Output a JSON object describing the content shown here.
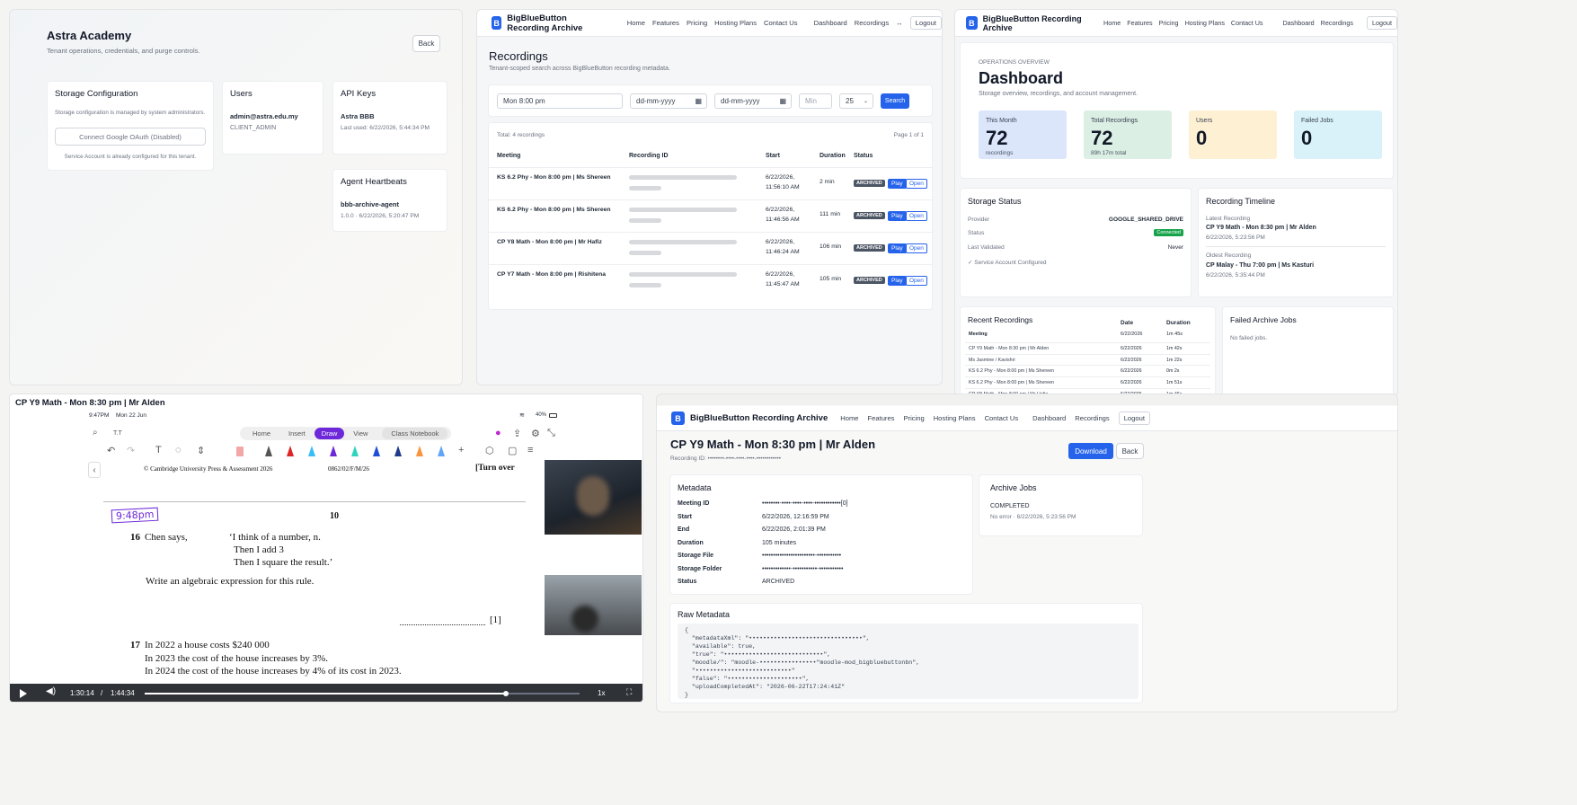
{
  "tenant": {
    "title": "Astra Academy",
    "subtitle": "Tenant operations, credentials, and purge controls.",
    "back_label": "Back",
    "storage": {
      "heading": "Storage Configuration",
      "note": "Storage configuration is managed by system administrators.",
      "oauth_button": "Connect Google OAuth (Disabled)",
      "footer": "Service Account is already configured for this tenant."
    },
    "users": {
      "heading": "Users",
      "email": "admin@astra.edu.my",
      "role": "CLIENT_ADMIN"
    },
    "api_keys": {
      "heading": "API Keys",
      "name": "Astra BBB",
      "last_used": "Last used: 6/22/2026, 5:44:34 PM"
    },
    "heartbeats": {
      "heading": "Agent Heartbeats",
      "agent": "bbb-archive-agent",
      "version": "1.0.0 · 6/22/2026, 5:20:47 PM"
    }
  },
  "brand": "BigBlueButton Recording Archive",
  "logo_letter": "B",
  "nav": {
    "home": "Home",
    "features": "Features",
    "pricing": "Pricing",
    "hosting": "Hosting Plans",
    "contact": "Contact Us",
    "dashboard": "Dashboard",
    "recordings": "Recordings",
    "more": "↔",
    "logout": "Logout"
  },
  "recordings_page": {
    "title": "Recordings",
    "subtitle": "Tenant-scoped search across BigBlueButton recording metadata.",
    "search_value": "Mon 8:00 pm",
    "date_from": "dd-mm-yyyy",
    "date_to": "dd-mm-yyyy",
    "min_placeholder": "Min",
    "page_size": "25",
    "search_button": "Search",
    "total": "Total: 4 recordings",
    "page": "Page 1 of 1",
    "columns": [
      "Meeting",
      "Recording ID",
      "Start",
      "Duration",
      "Status"
    ],
    "rows": [
      {
        "meeting": "KS 6.2 Phy - Mon 8:00 pm | Ms Shereen",
        "start1": "6/22/2026,",
        "start2": "11:56:10 AM",
        "duration": "2 min",
        "status": "ARCHIVED",
        "play": "Play",
        "open": "Open"
      },
      {
        "meeting": "KS 6.2 Phy - Mon 8:00 pm | Ms Shereen",
        "start1": "6/22/2026,",
        "start2": "11:46:56 AM",
        "duration": "111 min",
        "status": "ARCHIVED",
        "play": "Play",
        "open": "Open"
      },
      {
        "meeting": "CP Y8 Math - Mon 8:00 pm | Mr Hafiz",
        "start1": "6/22/2026,",
        "start2": "11:46:24 AM",
        "duration": "106 min",
        "status": "ARCHIVED",
        "play": "Play",
        "open": "Open"
      },
      {
        "meeting": "CP Y7 Math - Mon 8:00 pm | Rishitena",
        "start1": "6/22/2026,",
        "start2": "11:45:47 AM",
        "duration": "105 min",
        "status": "ARCHIVED",
        "play": "Play",
        "open": "Open"
      }
    ]
  },
  "dashboard": {
    "eyebrow": "OPERATIONS OVERVIEW",
    "title": "Dashboard",
    "subtitle": "Storage overview, recordings, and account management.",
    "stats": [
      {
        "label": "This Month",
        "value": "72",
        "sub": "recordings",
        "color": "#dbe6fb"
      },
      {
        "label": "Total Recordings",
        "value": "72",
        "sub": "89h 17m total",
        "color": "#dcefe4"
      },
      {
        "label": "Users",
        "value": "0",
        "sub": "",
        "color": "#fdf0d3"
      },
      {
        "label": "Failed Jobs",
        "value": "0",
        "sub": "",
        "color": "#d9f2f9"
      }
    ],
    "storage_status": {
      "heading": "Storage Status",
      "provider_label": "Provider",
      "provider": "GOOGLE_SHARED_DRIVE",
      "status_label": "Status",
      "status": "Connected",
      "validated_label": "Last Validated",
      "validated": "Never",
      "service": "✓ Service Account Configured"
    },
    "timeline": {
      "heading": "Recording Timeline",
      "latest_label": "Latest Recording",
      "latest_title": "CP Y9 Math - Mon 8:30 pm | Mr Alden",
      "latest_date": "6/22/2026, 5:23:56 PM",
      "oldest_label": "Oldest Recording",
      "oldest_title": "CP Malay - Thu 7:00 pm | Ms Kasturi",
      "oldest_date": "6/22/2026, 5:35:44 PM"
    },
    "recent": {
      "heading": "Recent Recordings",
      "columns": [
        "Meeting",
        "Date",
        "Duration"
      ],
      "rows": [
        {
          "m": "CP Y9 Math - Mon 8:30 pm | Mr Alden",
          "d": "6/22/2026",
          "t": "1m 42s"
        },
        {
          "m": "Ms Jasmine / Kavishri",
          "d": "6/22/2026",
          "t": "1m 22s"
        },
        {
          "m": "KS 6.2 Phy - Mon 8:00 pm | Ms Shereen",
          "d": "6/22/2026",
          "t": "0m 2s"
        },
        {
          "m": "KS 6.2 Phy - Mon 8:00 pm | Ms Shereen",
          "d": "6/22/2026",
          "t": "1m 51s"
        },
        {
          "m": "CP Y8 Math - Mon 8:00 pm | Mr Hafiz",
          "d": "6/22/2026",
          "t": "1m 46s"
        }
      ],
      "first_duration": "1m 45s"
    },
    "failed": {
      "heading": "Failed Archive Jobs",
      "empty": "No failed jobs."
    }
  },
  "player": {
    "title": "CP Y9 Math - Mon 8:30 pm | Mr Alden",
    "status_time": "9:47PM",
    "status_date": "Mon 22 Jun",
    "battery": "40%",
    "font_label": "T.T",
    "tabs": [
      "Home",
      "Insert",
      "Draw",
      "View",
      "Class Notebook"
    ],
    "active_tab": "Draw",
    "page_header_left": "© Cambridge University Press & Assessment 2026",
    "page_header_mid": "0862/02/F/M/26",
    "page_header_right": "[Turn over",
    "handwritten": "9:48pm",
    "page_number": "10",
    "q16_num": "16",
    "q16_text": "Chen says,",
    "q16_quote1": "‘I think of a number, n.",
    "q16_quote2": "Then I add 3",
    "q16_quote3": "Then I square the result.’",
    "q16_instruction": "Write an algebraic expression for this rule.",
    "q16_marks": "[1]",
    "q17_num": "17",
    "q17_l1": "In 2022 a house costs $240 000",
    "q17_l2": "In 2023 the cost of the house increases by 3%.",
    "q17_l3": "In 2024 the cost of the house increases by 4% of its cost in 2023.",
    "time_current": "1:30:14",
    "time_sep": "/",
    "time_total": "1:44:34",
    "speed": "1x",
    "progress": 0.83
  },
  "detail": {
    "title": "CP Y9 Math - Mon 8:30 pm | Mr Alden",
    "recording_id": "Recording ID: ••••••••-••••-••••-••••-••••••••••••",
    "download": "Download",
    "back": "Back",
    "metadata_heading": "Metadata",
    "metadata": [
      {
        "k": "Meeting ID",
        "v": "••••••••-••••-••••-••••-••••••••••••[0]"
      },
      {
        "k": "Start",
        "v": "6/22/2026, 12:16:59 PM"
      },
      {
        "k": "End",
        "v": "6/22/2026, 2:01:39 PM"
      },
      {
        "k": "Duration",
        "v": "105 minutes"
      },
      {
        "k": "Storage File",
        "v": "••••••••••••••••••••••••-•••••••••••"
      },
      {
        "k": "Storage Folder",
        "v": "•••••••••••••-•••••••••••-•••••••••••"
      },
      {
        "k": "Status",
        "v": "ARCHIVED"
      }
    ],
    "jobs_heading": "Archive Jobs",
    "job_status": "COMPLETED",
    "job_detail": "No error · 6/22/2026, 5:23:56 PM",
    "raw_heading": "Raw Metadata",
    "raw_lines": [
      "{",
      "  \"metadataXml\": \"••••••••••••••••••••••••••••••••\",",
      "  \"available\": true,",
      "  \"true\": \"••••••••••••••••••••••••••••\",",
      "  \"moodle/\": \"moodle-••••••••••••••••\"moodle-mod_bigbluebuttonbn\",",
      "  \"•••••••••••••••••••••••••••\"",
      "  \"false\": \"•••••••••••••••••••••\",",
      "  \"uploadCompletedAt\": \"2026-06-22T17:24:41Z\"",
      "}"
    ]
  }
}
